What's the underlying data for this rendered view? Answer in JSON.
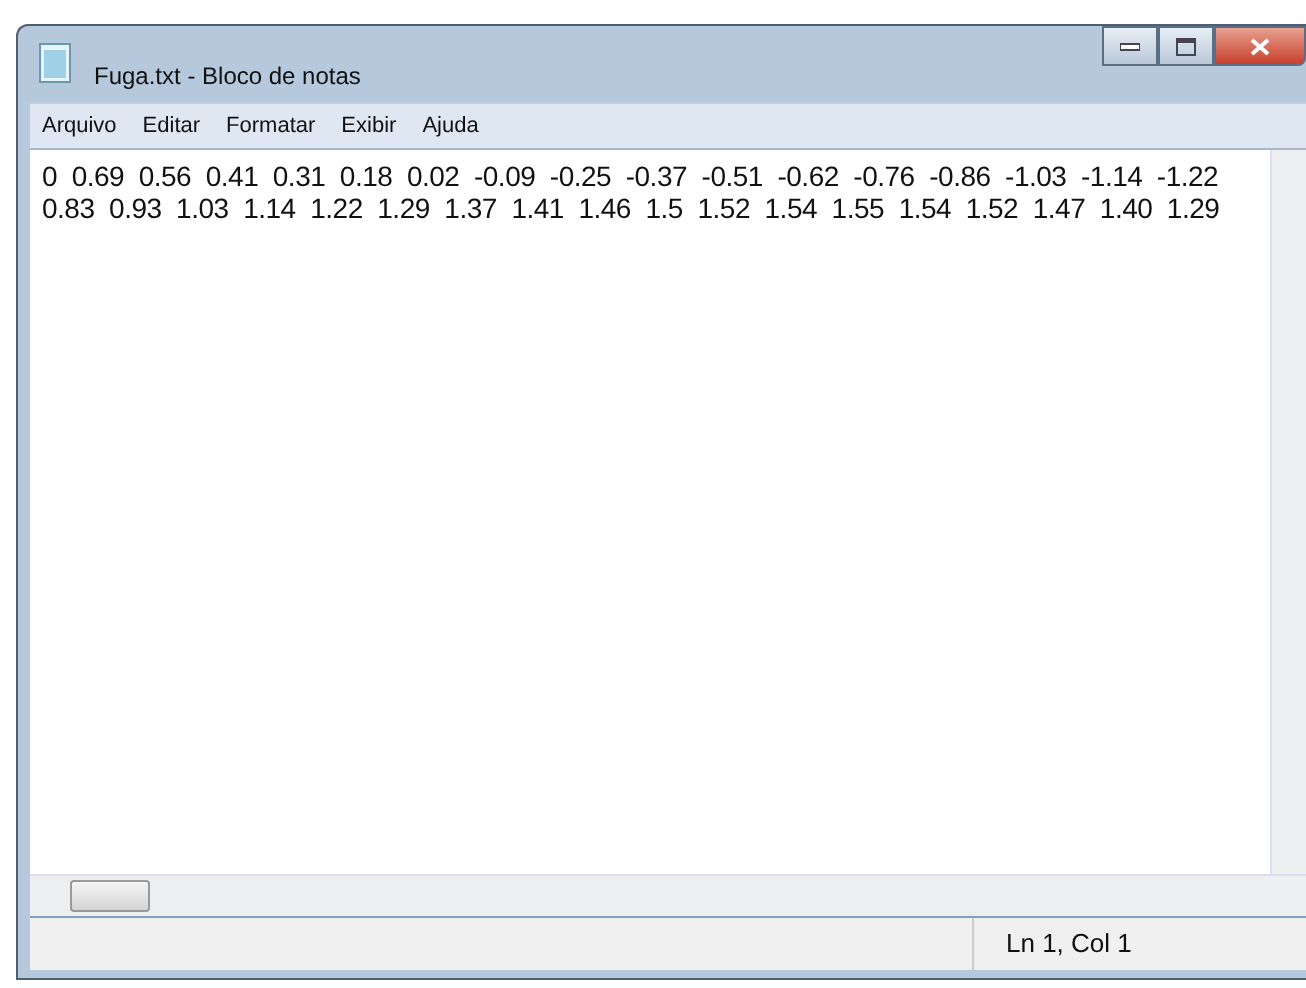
{
  "window": {
    "title": "Fuga.txt - Bloco de notas"
  },
  "menu": [
    "Arquivo",
    "Editar",
    "Formatar",
    "Exibir",
    "Ajuda"
  ],
  "document": {
    "lines": [
      "0  0.69  0.56  0.41  0.31  0.18  0.02  -0.09  -0.25  -0.37  -0.51  -0.62  -0.76  -0.86  -1.03  -1.14  -1.22",
      "0.83  0.93  1.03  1.14  1.22  1.29  1.37  1.41  1.46  1.5  1.52  1.54  1.55  1.54  1.52  1.47  1.40  1.29"
    ]
  },
  "status_bar": {
    "position": "Ln 1, Col 1"
  }
}
